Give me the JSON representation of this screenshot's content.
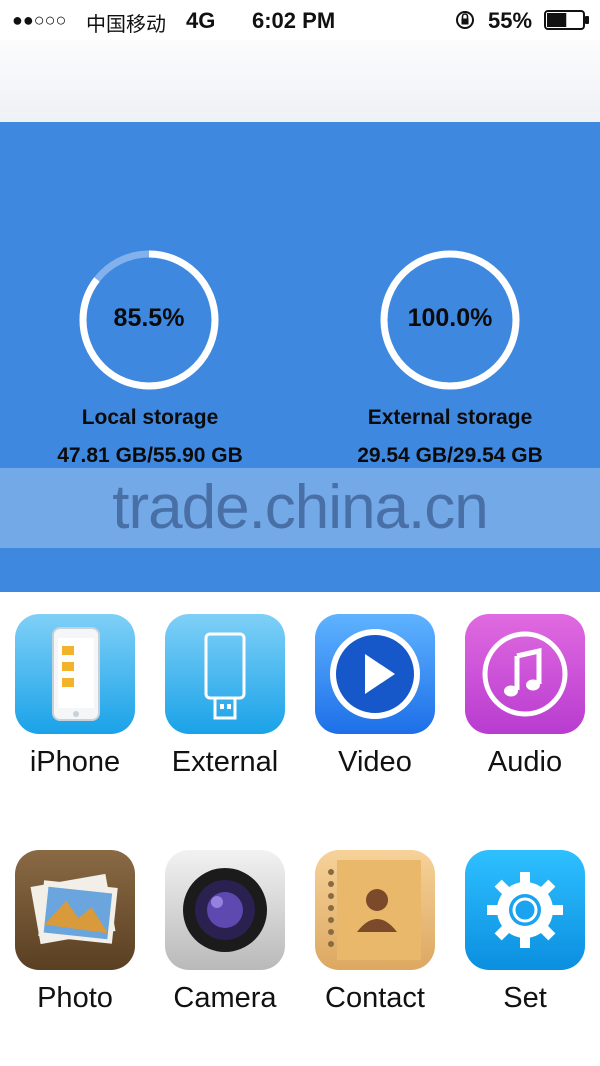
{
  "status_bar": {
    "signal": "●●○○○",
    "carrier": "中国移动",
    "network": "4G",
    "time": "6:02 PM",
    "battery_percent": "55%",
    "battery_level": 0.55
  },
  "storage": {
    "local": {
      "percent_label": "85.5%",
      "fraction": 0.855,
      "title": "Local storage",
      "amount": "47.81 GB/55.90 GB"
    },
    "external": {
      "percent_label": "100.0%",
      "fraction": 1.0,
      "title": "External storage",
      "amount": "29.54 GB/29.54 GB"
    }
  },
  "watermark": "trade.china.cn",
  "apps": [
    {
      "label": "iPhone",
      "icon": "iphone-icon"
    },
    {
      "label": "External",
      "icon": "usb-drive-icon"
    },
    {
      "label": "Video",
      "icon": "play-icon"
    },
    {
      "label": "Audio",
      "icon": "music-note-icon"
    },
    {
      "label": "Photo",
      "icon": "photo-stack-icon"
    },
    {
      "label": "Camera",
      "icon": "camera-lens-icon"
    },
    {
      "label": "Contact",
      "icon": "contact-book-icon"
    },
    {
      "label": "Set",
      "icon": "gear-icon"
    }
  ],
  "colors": {
    "panel_blue": "#3f88e0",
    "ring_white": "#ffffff",
    "audio_pink": "#cf4fd6",
    "video_blue": "#2d7ef0",
    "set_blue": "#15a3f0"
  }
}
